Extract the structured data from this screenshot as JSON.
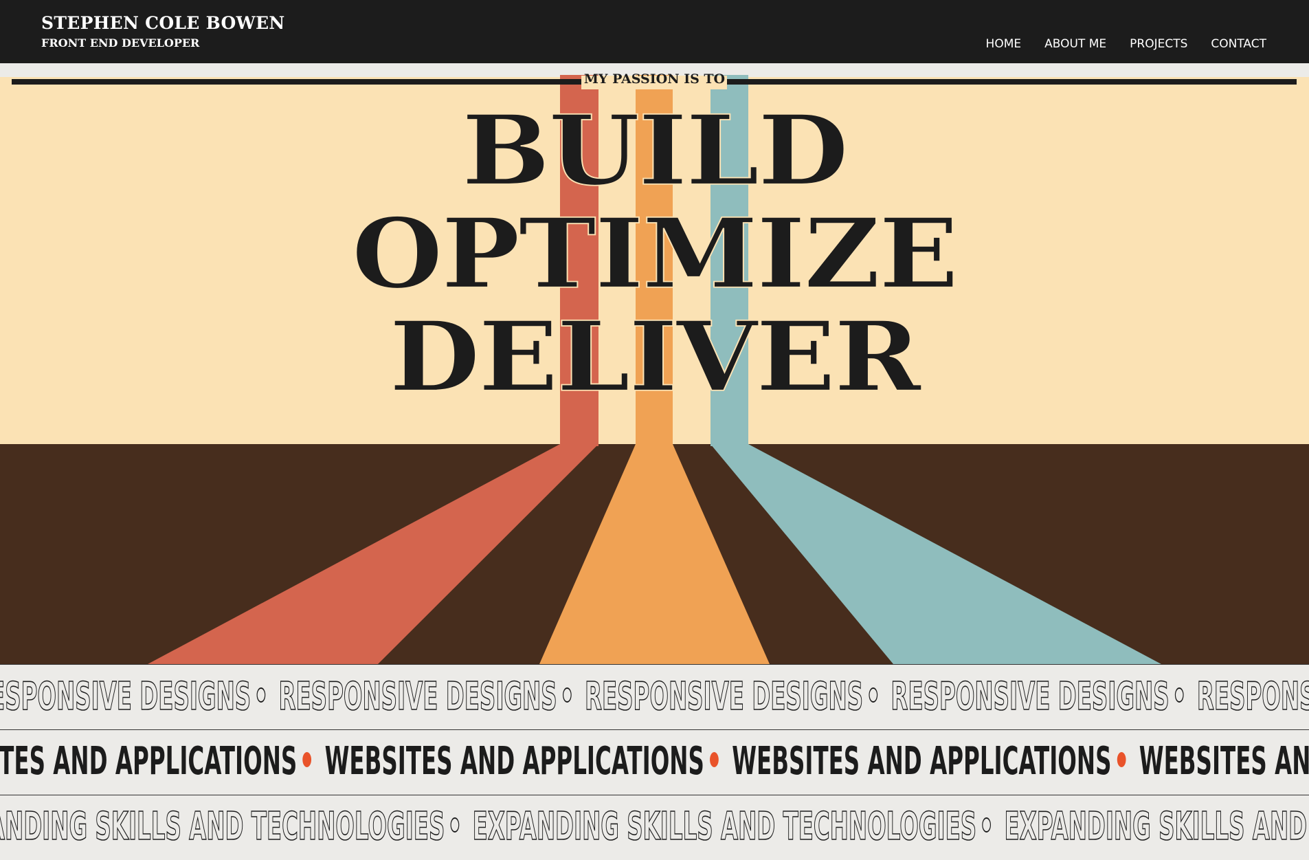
{
  "header": {
    "name": "STEPHEN COLE BOWEN",
    "role": "FRONT END DEVELOPER",
    "nav": [
      {
        "label": "HOME"
      },
      {
        "label": "ABOUT ME"
      },
      {
        "label": "PROJECTS"
      },
      {
        "label": "CONTACT"
      }
    ]
  },
  "hero": {
    "kicker": "MY PASSION IS TO",
    "words": [
      "BUILD",
      "OPTIMIZE",
      "DELIVER"
    ],
    "colors": {
      "sky": "#fbe2b4",
      "ground": "#472d1d",
      "stripe_red": "#d4654e",
      "stripe_orange": "#f0a254",
      "stripe_teal": "#8fbdbd",
      "ink": "#1c1c1c"
    }
  },
  "marquees": [
    {
      "text": "RESPONSIVE DESIGNS",
      "style": "outline",
      "separator": "ring"
    },
    {
      "text": "WEBSITES AND APPLICATIONS",
      "style": "solid",
      "separator": "orange-dot"
    },
    {
      "text": "EXPANDING SKILLS AND TECHNOLOGIES",
      "style": "outline",
      "separator": "ring"
    }
  ]
}
